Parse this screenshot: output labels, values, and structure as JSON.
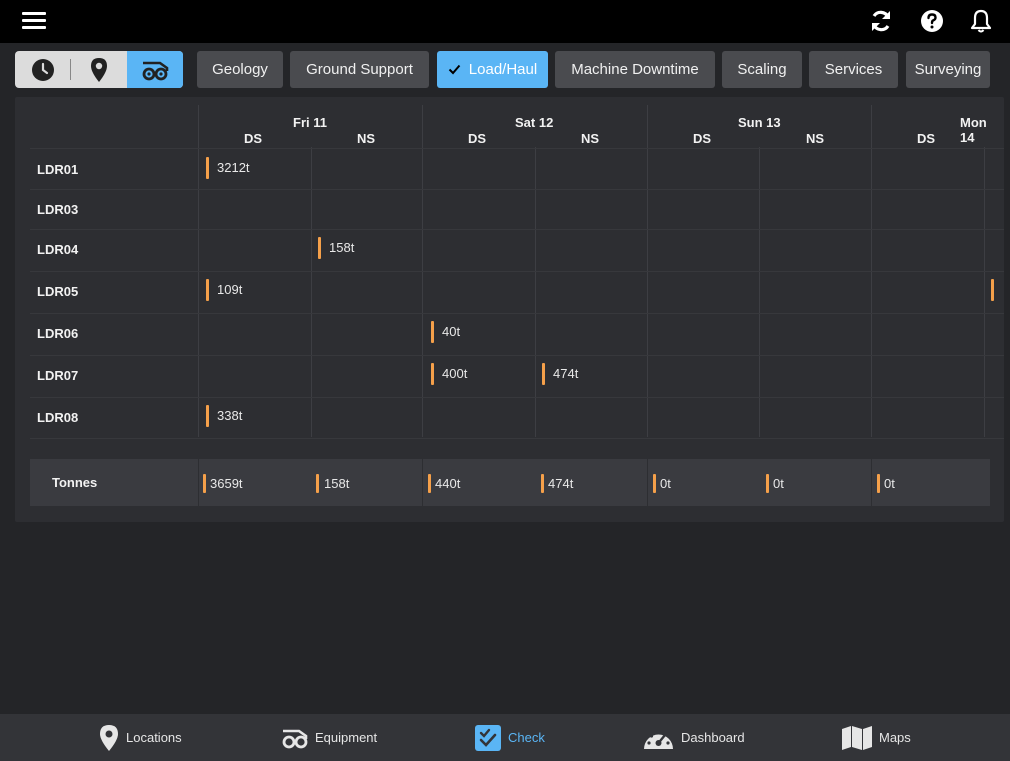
{
  "toolbar": {
    "menu_icon": "hamburger-icon",
    "refresh_icon": "refresh-icon",
    "help_icon": "help-icon",
    "notifications_icon": "bell-icon"
  },
  "view_toggle": {
    "items": [
      {
        "icon": "clock-icon",
        "selected": false
      },
      {
        "icon": "location-pin-icon",
        "selected": false
      },
      {
        "icon": "loader-icon",
        "selected": true
      }
    ]
  },
  "categories": [
    {
      "label": "Geology",
      "active": false
    },
    {
      "label": "Ground Support",
      "active": false
    },
    {
      "label": "Load/Haul",
      "active": true
    },
    {
      "label": "Machine Downtime",
      "active": false
    },
    {
      "label": "Scaling",
      "active": false
    },
    {
      "label": "Services",
      "active": false
    },
    {
      "label": "Surveying",
      "active": false
    }
  ],
  "schedule": {
    "days": [
      {
        "label": "Fri 11",
        "shifts": [
          "DS",
          "NS"
        ]
      },
      {
        "label": "Sat 12",
        "shifts": [
          "DS",
          "NS"
        ]
      },
      {
        "label": "Sun 13",
        "shifts": [
          "DS",
          "NS"
        ]
      },
      {
        "label": "Mon 14",
        "shifts": [
          "DS"
        ]
      }
    ],
    "rows": [
      {
        "label": "LDR01",
        "entries": [
          {
            "shift": 0,
            "value": "3212t"
          }
        ]
      },
      {
        "label": "LDR03",
        "entries": []
      },
      {
        "label": "LDR04",
        "entries": [
          {
            "shift": 1,
            "value": "158t"
          }
        ]
      },
      {
        "label": "LDR05",
        "entries": [
          {
            "shift": 0,
            "value": "109t"
          }
        ]
      },
      {
        "label": "LDR06",
        "entries": [
          {
            "shift": 2,
            "value": "40t"
          }
        ]
      },
      {
        "label": "LDR07",
        "entries": [
          {
            "shift": 2,
            "value": "400t"
          },
          {
            "shift": 3,
            "value": "474t"
          }
        ]
      },
      {
        "label": "LDR08",
        "entries": [
          {
            "shift": 0,
            "value": "338t"
          }
        ]
      }
    ],
    "totals": {
      "label": "Tonnes",
      "values": [
        "3659t",
        "158t",
        "440t",
        "474t",
        "0t",
        "0t",
        "0t"
      ]
    }
  },
  "bottom_nav": [
    {
      "label": "Locations",
      "icon": "location-pin-icon",
      "active": false
    },
    {
      "label": "Equipment",
      "icon": "loader-icon",
      "active": false
    },
    {
      "label": "Check",
      "icon": "checklist-icon",
      "active": true
    },
    {
      "label": "Dashboard",
      "icon": "gauge-icon",
      "active": false
    },
    {
      "label": "Maps",
      "icon": "map-icon",
      "active": false
    }
  ],
  "colors": {
    "accent": "#5ab5f5",
    "bar": "#f5a04a",
    "background": "#242528",
    "panel": "#2d2e32"
  }
}
